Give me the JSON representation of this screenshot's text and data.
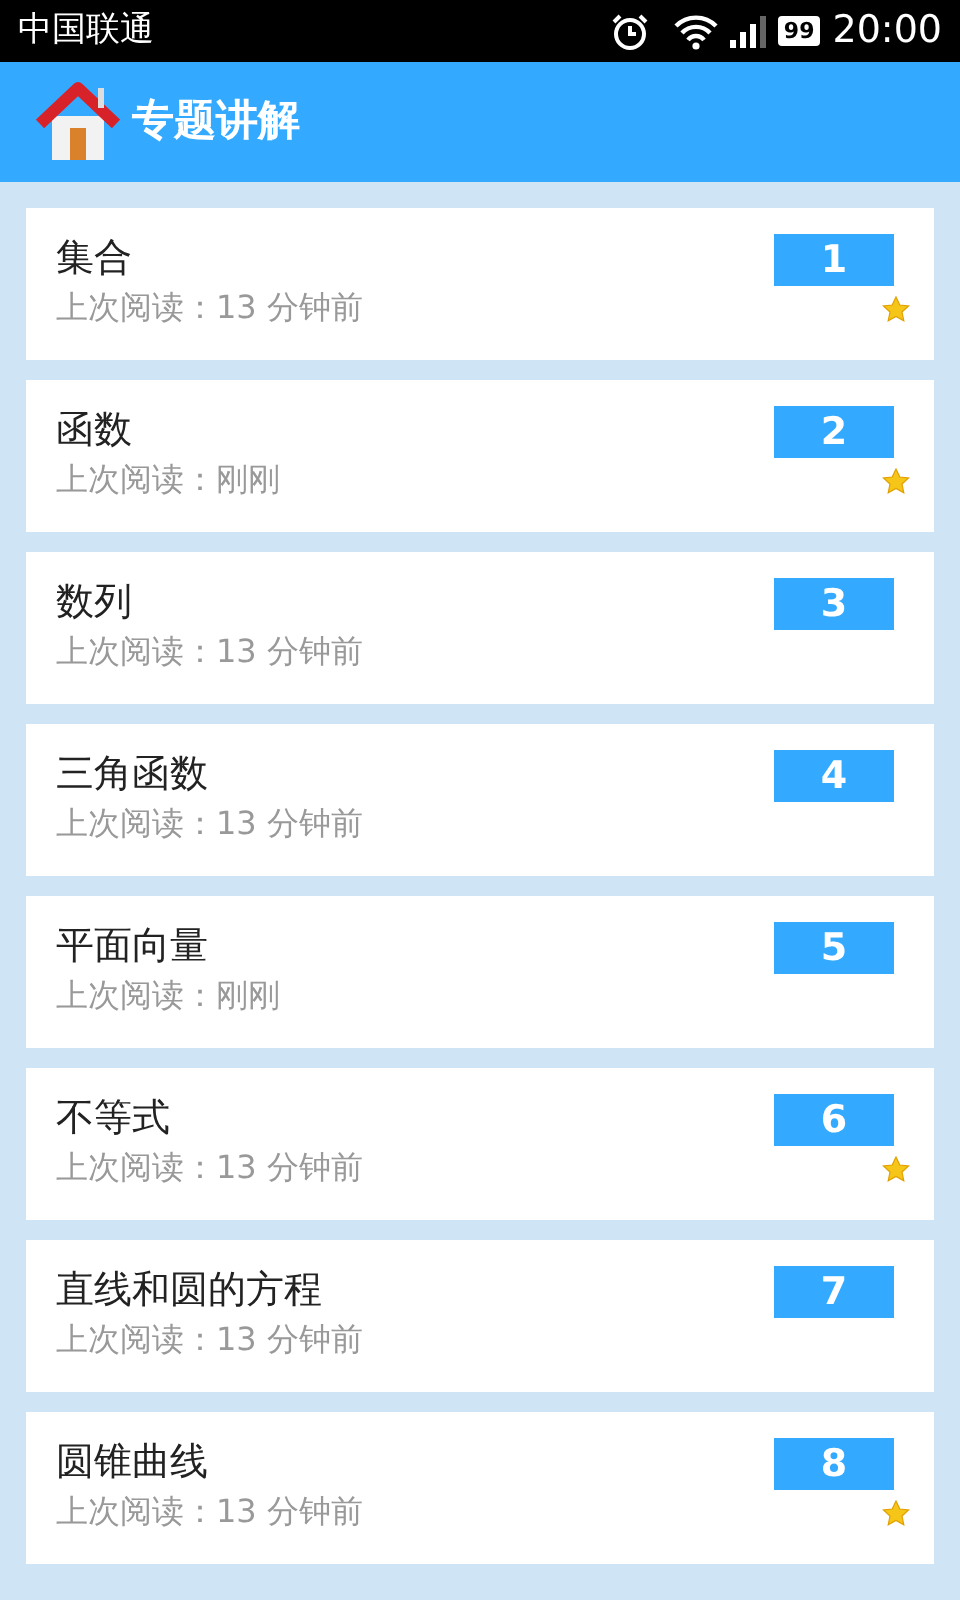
{
  "status_bar": {
    "carrier": "中国联通",
    "battery": "99",
    "time": "20:00"
  },
  "header": {
    "title": "专题讲解"
  },
  "topics": [
    {
      "title": "集合",
      "subtitle": "上次阅读：13 分钟前",
      "number": "1",
      "starred": true
    },
    {
      "title": "函数",
      "subtitle": "上次阅读：刚刚",
      "number": "2",
      "starred": true
    },
    {
      "title": "数列",
      "subtitle": "上次阅读：13 分钟前",
      "number": "3",
      "starred": false
    },
    {
      "title": "三角函数",
      "subtitle": "上次阅读：13 分钟前",
      "number": "4",
      "starred": false
    },
    {
      "title": "平面向量",
      "subtitle": "上次阅读：刚刚",
      "number": "5",
      "starred": false
    },
    {
      "title": "不等式",
      "subtitle": "上次阅读：13 分钟前",
      "number": "6",
      "starred": true
    },
    {
      "title": "直线和圆的方程",
      "subtitle": "上次阅读：13 分钟前",
      "number": "7",
      "starred": false
    },
    {
      "title": "圆锥曲线",
      "subtitle": "上次阅读：13 分钟前",
      "number": "8",
      "starred": true
    }
  ]
}
